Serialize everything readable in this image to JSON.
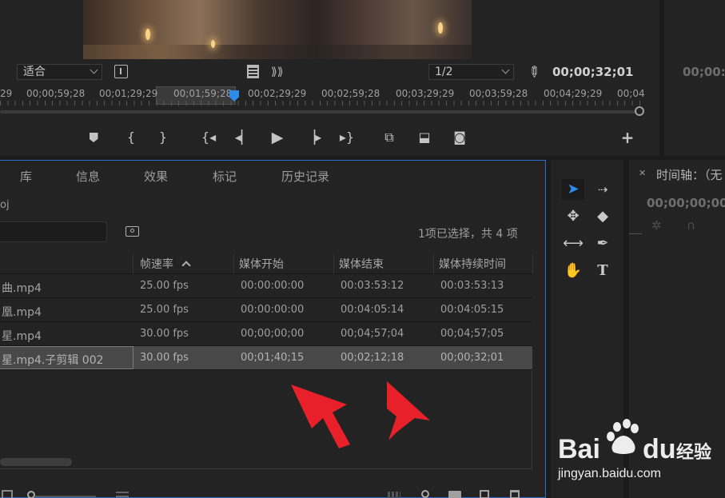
{
  "program_monitor": {
    "fit_dropdown": "适合",
    "resolution_dropdown": "1/2",
    "timecode": "00;00;32;01",
    "ruler_labels": [
      "29",
      "00;00;59;28",
      "00;01;29;29",
      "00;01;59;28",
      "00;02;29;29",
      "00;02;59;28",
      "00;03;29;29",
      "00;03;59;28",
      "00;04;29;29",
      "00;04"
    ],
    "transport_buttons": [
      "add-marker",
      "mark-in",
      "mark-out",
      "go-to-in",
      "step-back",
      "play",
      "step-forward",
      "go-to-out",
      "insert",
      "overwrite",
      "export-frame",
      "add-button"
    ]
  },
  "right_top_panel": {
    "timecode": "00;00:"
  },
  "project_panel": {
    "tabs": [
      "库",
      "信息",
      "效果",
      "标记",
      "历史记录"
    ],
    "project_name_partial": "oj",
    "selection_status": "1项已选择，共 4 项",
    "columns": {
      "frame_rate": "帧速率",
      "media_start": "媒体开始",
      "media_end": "媒体结束",
      "media_duration": "媒体持续时间"
    },
    "rows": [
      {
        "name": "曲.mp4",
        "fps": "25.00 fps",
        "start": "00:00:00:00",
        "end": "00:03:53:12",
        "duration": "00:03:53:13",
        "selected": false
      },
      {
        "name": "凰.mp4",
        "fps": "25.00 fps",
        "start": "00:00:00:00",
        "end": "00:04:05:14",
        "duration": "00:04:05:15",
        "selected": false
      },
      {
        "name": "星.mp4",
        "fps": "30.00 fps",
        "start": "00;00;00;00",
        "end": "00;04;57;04",
        "duration": "00;04;57;05",
        "selected": false
      },
      {
        "name": "星.mp4.子剪辑 002",
        "fps": "30.00 fps",
        "start": "00;01;40;15",
        "end": "00;02;12;18",
        "duration": "00;00;32;01",
        "selected": true
      }
    ]
  },
  "timeline_panel": {
    "title": "时间轴：（无",
    "timecode": "00;00;00;00"
  },
  "watermark": {
    "logo_text": "Bai du 经验",
    "url": "jingyan.baidu.com"
  },
  "colors": {
    "accent_blue": "#2d8ceb",
    "annotation_red": "#e8202a",
    "panel_bg": "#232323"
  }
}
